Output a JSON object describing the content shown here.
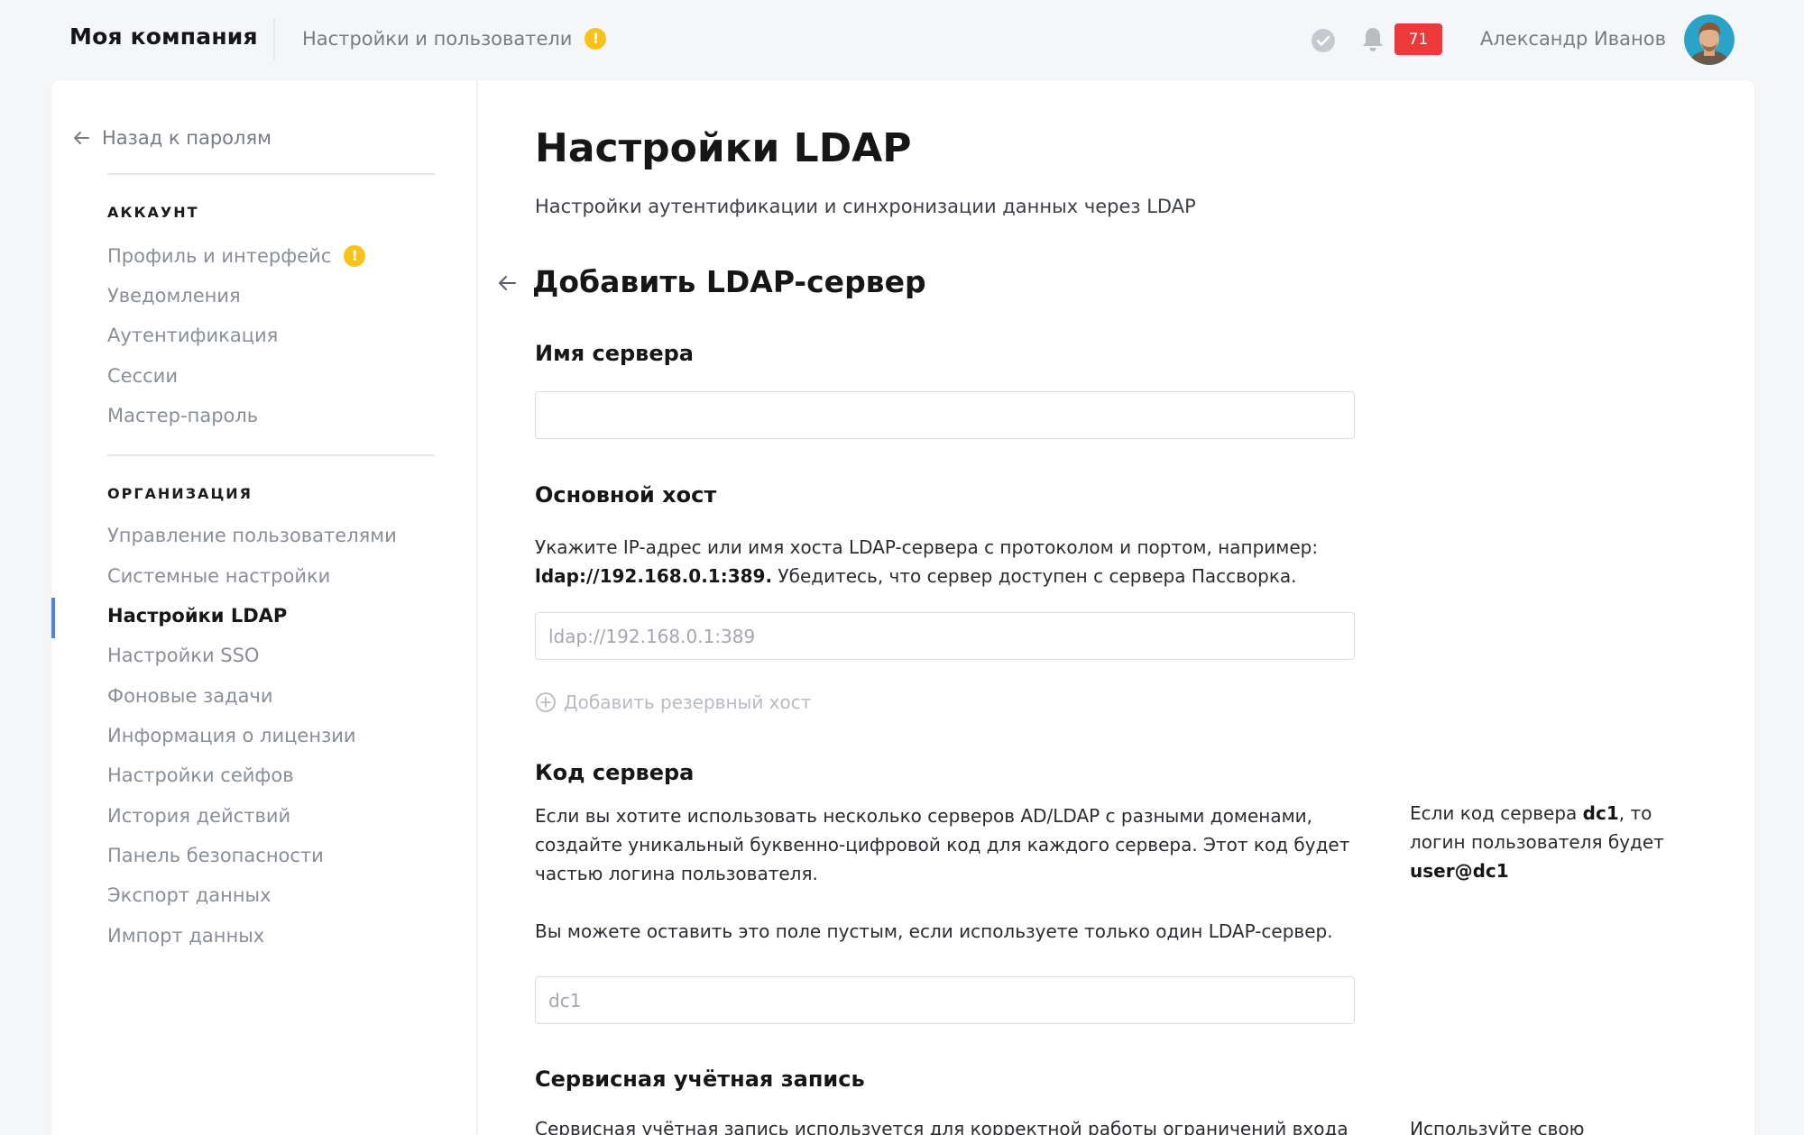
{
  "header": {
    "company": "Моя компания",
    "breadcrumb": "Настройки и пользователи",
    "breadcrumb_badge": "!",
    "notifications_count": "71",
    "user_name": "Александр Иванов"
  },
  "sidebar": {
    "back_label": "Назад к паролям",
    "account_title": "АККАУНТ",
    "account_items": [
      {
        "label": "Профиль и интерфейс",
        "badge": "!"
      },
      {
        "label": "Уведомления"
      },
      {
        "label": "Аутентификация"
      },
      {
        "label": "Сессии"
      },
      {
        "label": "Мастер-пароль"
      }
    ],
    "org_title": "ОРГАНИЗАЦИЯ",
    "org_items": [
      {
        "label": "Управление пользователями"
      },
      {
        "label": "Системные настройки"
      },
      {
        "label": "Настройки LDAP",
        "active": true
      },
      {
        "label": "Настройки SSO"
      },
      {
        "label": "Фоновые задачи"
      },
      {
        "label": "Информация о лицензии"
      },
      {
        "label": "Настройки сейфов"
      },
      {
        "label": "История действий"
      },
      {
        "label": "Панель безопасности"
      },
      {
        "label": "Экспорт данных"
      },
      {
        "label": "Импорт данных"
      }
    ]
  },
  "main": {
    "title": "Настройки LDAP",
    "subtitle": "Настройки аутентификации и синхронизации данных через LDAP",
    "form_title": "Добавить LDAP-сервер",
    "server_name": {
      "label": "Имя сервера",
      "value": "",
      "placeholder": ""
    },
    "primary_host": {
      "label": "Основной хост",
      "help_before": "Укажите IP-адрес или имя хоста LDAP-сервера с протоколом и портом, например:",
      "help_example": "ldap://192.168.0.1:389.",
      "help_after": "Убедитесь, что сервер доступен с сервера Пассворка.",
      "placeholder": "ldap://192.168.0.1:389",
      "add_backup": "Добавить резервный хост"
    },
    "server_code": {
      "label": "Код сервера",
      "help_1": "Если вы хотите использовать несколько серверов AD/LDAP с разными доменами, создайте уникальный буквенно-цифровой код для каждого сервера. Этот код будет частью логина пользователя.",
      "help_2": "Вы можете оставить это поле пустым, если используете только один LDAP-сервер.",
      "placeholder": "dc1",
      "note_1": "Если код сервера",
      "note_code": "dc1",
      "note_2": ", то логин пользователя будет",
      "note_login": "user@dc1"
    },
    "service_account": {
      "label": "Сервисная учётная запись",
      "help": "Сервисная учётная запись используется для корректной работы ограничений входа",
      "note": "Используйте свою"
    }
  },
  "colors": {
    "accent": "#4b84e6",
    "badge_red": "#ec3a3a",
    "warning_yellow": "#f8c21a"
  }
}
